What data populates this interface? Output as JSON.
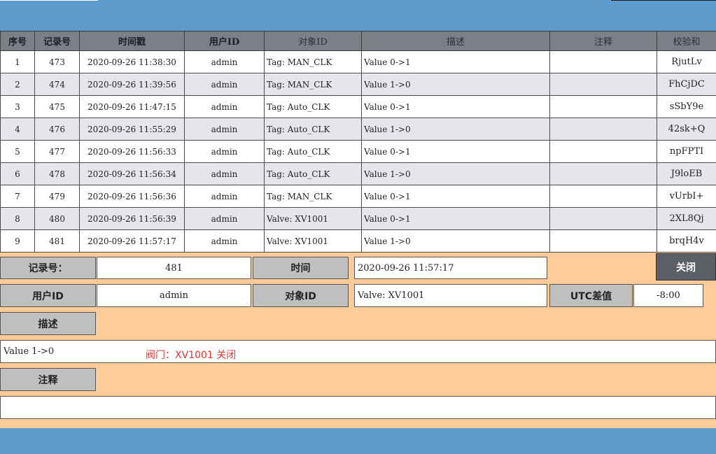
{
  "table": {
    "headers": [
      "序号",
      "记录号",
      "时间戳",
      "用户ID",
      "对象ID",
      "描述",
      "注释",
      "校验和"
    ],
    "rows": [
      {
        "seq": "1",
        "rec": "473",
        "ts": "2020-09-26 11:38:30",
        "user": "admin",
        "obj": "Tag: MAN_CLK",
        "desc": "Value 0->1",
        "note": "",
        "chk": "RjutLv"
      },
      {
        "seq": "2",
        "rec": "474",
        "ts": "2020-09-26 11:39:56",
        "user": "admin",
        "obj": "Tag: MAN_CLK",
        "desc": "Value 1->0",
        "note": "",
        "chk": "FhCjDC"
      },
      {
        "seq": "3",
        "rec": "475",
        "ts": "2020-09-26 11:47:15",
        "user": "admin",
        "obj": "Tag: Auto_CLK",
        "desc": "Value 0->1",
        "note": "",
        "chk": "sSbY9e"
      },
      {
        "seq": "4",
        "rec": "476",
        "ts": "2020-09-26 11:55:29",
        "user": "admin",
        "obj": "Tag: Auto_CLK",
        "desc": "Value 1->0",
        "note": "",
        "chk": "42sk+Q"
      },
      {
        "seq": "5",
        "rec": "477",
        "ts": "2020-09-26 11:56:33",
        "user": "admin",
        "obj": "Tag: Auto_CLK",
        "desc": "Value 0->1",
        "note": "",
        "chk": "npFPTI"
      },
      {
        "seq": "6",
        "rec": "478",
        "ts": "2020-09-26 11:56:34",
        "user": "admin",
        "obj": "Tag: Auto_CLK",
        "desc": "Value 1->0",
        "note": "",
        "chk": "J9loEB"
      },
      {
        "seq": "7",
        "rec": "479",
        "ts": "2020-09-26 11:56:36",
        "user": "admin",
        "obj": "Tag: MAN_CLK",
        "desc": "Value 0->1",
        "note": "",
        "chk": "vUrbI+"
      },
      {
        "seq": "8",
        "rec": "480",
        "ts": "2020-09-26 11:56:39",
        "user": "admin",
        "obj": "Valve: XV1001",
        "desc": "Value 0->1",
        "note": "",
        "chk": "2XL8Qj"
      },
      {
        "seq": "9",
        "rec": "481",
        "ts": "2020-09-26 11:57:17",
        "user": "admin",
        "obj": "Valve: XV1001",
        "desc": "Value 1->0",
        "note": "",
        "chk": "brqH4v"
      }
    ]
  },
  "detail": {
    "record_label": "记录号：",
    "record_value": "481",
    "time_label": "时间",
    "time_value": "2020-09-26 11:57:17",
    "close_label": "关闭",
    "user_label": "用户ID",
    "user_value": "admin",
    "object_label": "对象ID",
    "object_value": "Valve: XV1001",
    "utc_label": "UTC差值",
    "utc_value": "-8:00",
    "desc_label": "描述",
    "desc_value": "Value 1->0",
    "desc_note": "阀门：XV1001 关闭",
    "note_label": "注释",
    "note_value": ""
  },
  "colors": {
    "header_bg": "#5e9bcd",
    "table_header_bg": "#7d7f86",
    "detail_bg": "#ffcc99",
    "label_bg": "#c0c0c0",
    "close_bg": "#5d5f66",
    "note_red": "#e8322b"
  }
}
